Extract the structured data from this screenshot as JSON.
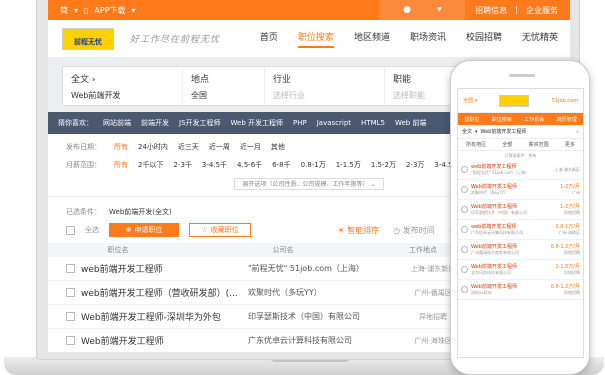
{
  "topbar": {
    "menu_label": "简",
    "app_download": "APP下载",
    "links": [
      "招聘信息",
      "企业服务"
    ]
  },
  "header": {
    "logo_text": "前程无忧",
    "slogan": "好工作尽在前程无忧",
    "nav": [
      {
        "label": "首页",
        "active": false
      },
      {
        "label": "职位搜索",
        "active": true
      },
      {
        "label": "地区频道",
        "active": false
      },
      {
        "label": "职场资讯",
        "active": false
      },
      {
        "label": "校园招聘",
        "active": false
      },
      {
        "label": "无忧精英",
        "active": false
      }
    ]
  },
  "search": {
    "fulltext_label": "全文",
    "keyword": "Web前端开发",
    "location_label": "地点",
    "location_value": "全国",
    "industry_label": "行业",
    "industry_placeholder": "选择行业",
    "function_label": "职能",
    "function_placeholder": "选择职能"
  },
  "hot_searches": {
    "label": "猜你喜欢：",
    "items": [
      "网站前端",
      "前端开发",
      "JS开发工程师",
      "Web 开发工程师",
      "PHP",
      "Javascript",
      "HTML5",
      "Web 前端"
    ]
  },
  "filters": {
    "date": {
      "label": "发布日期：",
      "options": [
        "所有",
        "24小时内",
        "近三天",
        "近一周",
        "近一月",
        "其他"
      ],
      "selected": "所有"
    },
    "salary": {
      "label": "月薪范围：",
      "options": [
        "所有",
        "2千以下",
        "2-3千",
        "3-4.5千",
        "4.5-6千",
        "6-8千",
        "0.8-1万",
        "1-1.5万",
        "1.5-2万",
        "2-3万",
        "3-4.5万",
        "4.5"
      ],
      "selected": "所有"
    },
    "expand_label": "展开选项（公司性质、公司规模、工作年限等）"
  },
  "conditions": {
    "label": "已选条件：",
    "value": "Web前端开发(全文)"
  },
  "actions": {
    "select_all": "全选",
    "apply": "申请职位",
    "favorite": "收藏职位",
    "smart_sort": "智能排序",
    "pub_time": "发布时间"
  },
  "table": {
    "headers": [
      "职位名",
      "公司名",
      "工作地点"
    ],
    "rows": [
      {
        "title": "web前端开发工程师",
        "company": "\"前程无忧\" 51job.com（上海）",
        "location": "上海-浦东新区",
        "salary": ""
      },
      {
        "title": "web前端开发工程师（营收研发部）(...",
        "company": "欢聚时代（多玩YY）",
        "location": "广州-番禺区",
        "salary": "1-2"
      },
      {
        "title": "Web前端开发工程师-深圳华为外包",
        "company": "印孚瑟斯技术（中国）有限公司",
        "location": "异地招聘",
        "salary": "1-2"
      },
      {
        "title": "Web前端开发工程师",
        "company": "广东优卓云计算科技有限公司",
        "location": "广州-海珠区",
        "salary": "0.8-1"
      },
      {
        "title": "Web前端开发工程师",
        "company": "广州嘉瑞电子商务有限公司",
        "location": "异地招聘",
        "salary": "0.8-1"
      }
    ]
  },
  "mobile": {
    "location": "全国",
    "brand": "前程无忧",
    "site": "51job.com",
    "tabs": [
      "找职位",
      "职位搜索",
      "工作机会",
      "简历管理"
    ],
    "search_type": "全文",
    "search_text": "Web前端开发工程师",
    "filter_tabs": [
      "所有地区",
      "全部",
      "薪资范围",
      "更多"
    ],
    "conditions": "已筛选条件：所有",
    "jobs": [
      {
        "title": "web前端开发工程师",
        "company": "\"前程无忧\" 51job.com（上海）",
        "salary": "",
        "location": "上海-浦东新区"
      },
      {
        "title": "Web前端开发工程师",
        "company": "欢聚时代（多玩YY）",
        "salary": "1-2万/月",
        "location": "广州"
      },
      {
        "title": "Web前端开发工程师",
        "company": "印孚瑟斯技术（中国）有限公司",
        "salary": "1-2万/月",
        "location": "异地招聘"
      },
      {
        "title": "web前端开发工程师",
        "company": "广东优卓云计算科技有限公司",
        "salary": "0.8-1万/月",
        "location": "广州-海珠区"
      },
      {
        "title": "Web前端开发工程师",
        "company": "广州嘉瑞电子商务有限公司",
        "salary": "0.8-1.2万/月",
        "location": "异地招聘"
      },
      {
        "title": "Web前端开发工程师",
        "company": "北京讯加科技有限公司",
        "salary": "1-1.5万/月",
        "location": "异地招聘"
      },
      {
        "title": "Web前端开发工程师",
        "company": "深圳xx科技",
        "salary": "0.8-1.2万/月",
        "location": "异地招聘"
      }
    ]
  }
}
